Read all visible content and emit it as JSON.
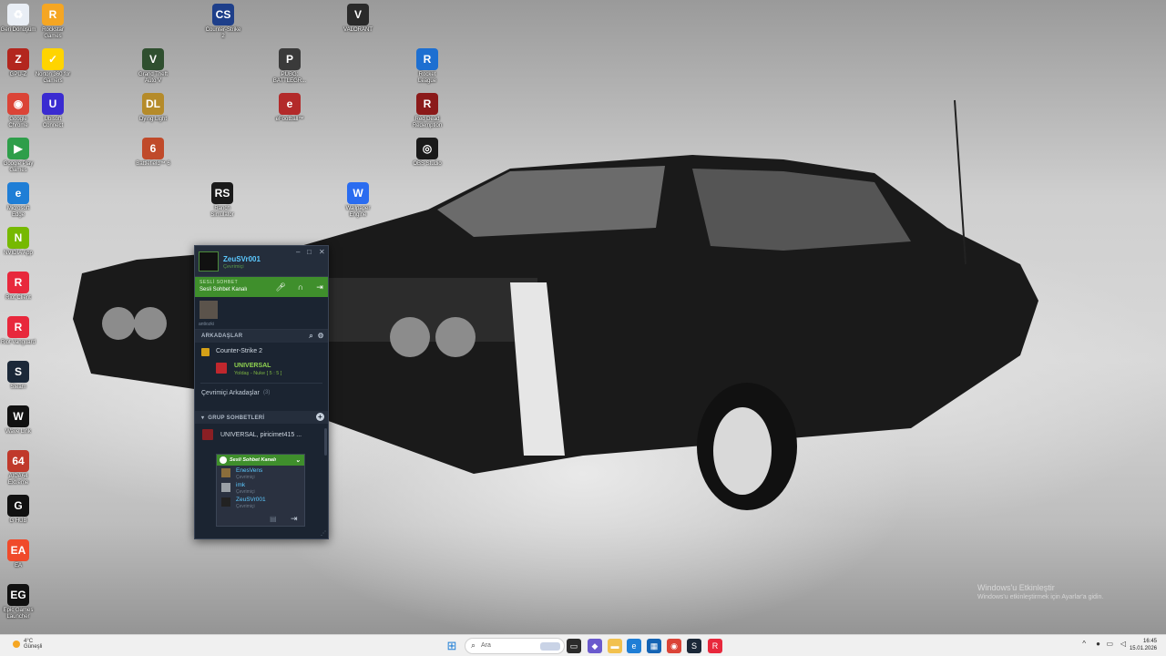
{
  "desktop": {
    "icons": [
      {
        "label": "Geri Dönüşüm",
        "name": "recycle-bin-icon",
        "color": "#e9eef5",
        "glyph": "♻"
      },
      {
        "label": "Rockstar Games",
        "name": "rockstar-launcher-icon",
        "color": "#f5a623",
        "glyph": "R"
      },
      {
        "label": "Counter-Strike 2",
        "name": "counter-strike-icon",
        "color": "#1e3f8a",
        "glyph": "CS"
      },
      {
        "label": "VALORANT",
        "name": "valorant-icon",
        "color": "#2a2a2a",
        "glyph": "V"
      },
      {
        "label": "GPU-Z",
        "name": "gpu-z-icon",
        "color": "#b3261e",
        "glyph": "Z"
      },
      {
        "label": "Norton 360 for Gamers",
        "name": "norton-icon",
        "color": "#ffd400",
        "glyph": "✓"
      },
      {
        "label": "Grand Theft Auto V",
        "name": "gta-v-icon",
        "color": "#2f4f2f",
        "glyph": "V"
      },
      {
        "label": "PUBG: BATTLEGR...",
        "name": "pubg-icon",
        "color": "#3a3a3a",
        "glyph": "P"
      },
      {
        "label": "Rocket League",
        "name": "rocket-league-icon",
        "color": "#1d6fd1",
        "glyph": "R"
      },
      {
        "label": "Google Chrome",
        "name": "chrome-icon",
        "color": "#db4437",
        "glyph": "◉"
      },
      {
        "label": "Ubisoft Connect",
        "name": "ubisoft-icon",
        "color": "#3a2bd1",
        "glyph": "U"
      },
      {
        "label": "Dying Light",
        "name": "dying-light-icon",
        "color": "#b58b2a",
        "glyph": "DL"
      },
      {
        "label": "eFootball™",
        "name": "efootball-icon",
        "color": "#b32a2a",
        "glyph": "e"
      },
      {
        "label": "Red Dead Redemption",
        "name": "rdr-icon",
        "color": "#8b1a1a",
        "glyph": "R"
      },
      {
        "label": "Google Play Games",
        "name": "play-games-icon",
        "color": "#2e9e4a",
        "glyph": "▶"
      },
      {
        "label": "Battlefield™ 6",
        "name": "battlefield-icon",
        "color": "#c04a2a",
        "glyph": "6"
      },
      {
        "label": "OBS Studio",
        "name": "obs-icon",
        "color": "#1a1a1a",
        "glyph": "◎"
      },
      {
        "label": "Microsoft Edge",
        "name": "edge-icon",
        "color": "#1f7ed6",
        "glyph": "e"
      },
      {
        "label": "Ranch Simulator",
        "name": "ranch-simulator-icon",
        "color": "#1a1a1a",
        "glyph": "RS"
      },
      {
        "label": "Wallpaper Engine",
        "name": "wallpaper-engine-icon",
        "color": "#2a6cf0",
        "glyph": "W"
      },
      {
        "label": "NVIDIA App",
        "name": "nvidia-icon",
        "color": "#76b900",
        "glyph": "N"
      },
      {
        "label": "Riot Client",
        "name": "riot-client-icon",
        "color": "#e8283c",
        "glyph": "R"
      },
      {
        "label": "Riot Vanguard",
        "name": "riot-vanguard-icon",
        "color": "#e8283c",
        "glyph": "R"
      },
      {
        "label": "Steam",
        "name": "steam-icon",
        "color": "#1b2838",
        "glyph": "S"
      },
      {
        "label": "Wave Link",
        "name": "wave-link-icon",
        "color": "#111111",
        "glyph": "W"
      },
      {
        "label": "AIDA64 Extreme",
        "name": "aida64-icon",
        "color": "#c0392b",
        "glyph": "64"
      },
      {
        "label": "G HUB",
        "name": "g-hub-icon",
        "color": "#111111",
        "glyph": "G"
      },
      {
        "label": "EA",
        "name": "ea-icon",
        "color": "#f04a2a",
        "glyph": "EA"
      },
      {
        "label": "Epic Games Launcher",
        "name": "epic-games-icon",
        "color": "#111111",
        "glyph": "EG"
      }
    ]
  },
  "friends_window": {
    "username": "ZeuSVr001",
    "status": "Çevrimiçi",
    "voice": {
      "title": "SESLİ SOHBET",
      "channel": "Sesli Sohbet Kanalı"
    },
    "voice_member": "antiozki",
    "friends_header": "ARKADAŞLAR",
    "game_name": "Counter-Strike 2",
    "playing_friend": {
      "name": "UNIVERSAL",
      "detail": "Yoldaş - Nuke [ 5 : 5 ]"
    },
    "online_label": "Çevrimiçi Arkadaşlar",
    "online_count": "(3)",
    "group_header": "GRUP SOHBETLERİ",
    "group_name": "UNIVERSAL, piricimet415 ...",
    "group_channel": "Sesli Sohbet Kanalı",
    "members": [
      {
        "name": "EnesVens",
        "status": "Çevrimiçi"
      },
      {
        "name": "imk",
        "status": "Çevrimiçi"
      },
      {
        "name": "ZeuSVr001",
        "status": "Çevrimiçi"
      }
    ]
  },
  "watermark": {
    "title": "Windows'u Etkinleştir",
    "subtitle": "Windows'u etkinleştirmek için Ayarlar'a gidin."
  },
  "taskbar": {
    "weather_temp": "4°C",
    "weather_text": "Güneşli",
    "search_placeholder": "Ara",
    "time": "16:45",
    "date": "15.01.2026"
  }
}
